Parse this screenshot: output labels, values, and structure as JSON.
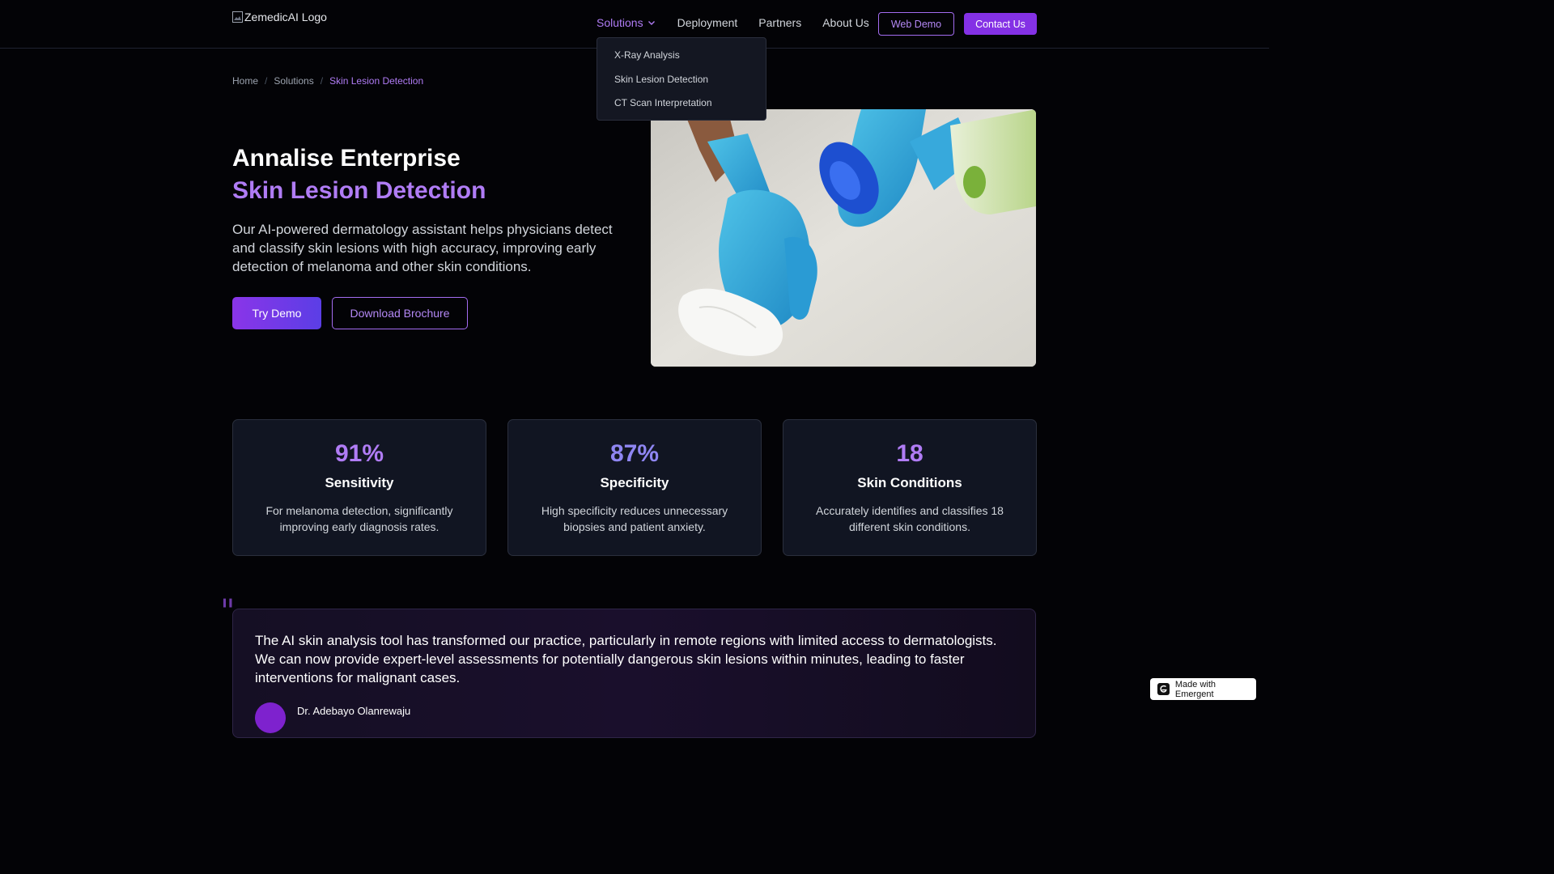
{
  "header": {
    "logo_alt": "ZemedicAI Logo",
    "nav": [
      {
        "label": "Solutions",
        "active": true
      },
      {
        "label": "Deployment"
      },
      {
        "label": "Partners"
      },
      {
        "label": "About Us"
      }
    ],
    "web_demo_label": "Web Demo",
    "contact_label": "Contact Us"
  },
  "solutions_menu": {
    "items": [
      "X-Ray Analysis",
      "Skin Lesion Detection",
      "CT Scan Interpretation"
    ]
  },
  "breadcrumb": {
    "items": [
      "Home",
      "Solutions",
      "Skin Lesion Detection"
    ],
    "separator": "/"
  },
  "hero": {
    "title": "Annalise Enterprise",
    "subtitle": "Skin Lesion Detection",
    "description": "Our AI-powered dermatology assistant helps physicians detect and classify skin lesions with high accuracy, improving early detection of melanoma and other skin conditions.",
    "try_demo_label": "Try Demo",
    "brochure_label": "Download Brochure",
    "image_icon": "gloved-hand-cleaning-photo"
  },
  "stats": [
    {
      "value": "91%",
      "label": "Sensitivity",
      "description": "For melanoma detection, significantly improving early diagnosis rates.",
      "color": "#b07cf5"
    },
    {
      "value": "87%",
      "label": "Specificity",
      "description": "High specificity reduces unnecessary biopsies and patient anxiety.",
      "color": "#8f86f2"
    },
    {
      "value": "18",
      "label": "Skin Conditions",
      "description": "Accurately identifies and classifies 18 different skin conditions.",
      "color": "#b07cf5"
    }
  ],
  "testimonial": {
    "quote_mark": "\"",
    "text": "The AI skin analysis tool has transformed our practice, particularly in remote regions with limited access to dermatologists. We can now provide expert-level assessments for potentially dangerous skin lesions within minutes, leading to faster interventions for malignant cases.",
    "author": "Dr. Adebayo Olanrewaju"
  },
  "badge": {
    "label": "Made with Emergent"
  },
  "colors": {
    "accent": "#b07cf5",
    "primary_button": "#8431e5",
    "background": "#030306",
    "card": "#111522"
  }
}
